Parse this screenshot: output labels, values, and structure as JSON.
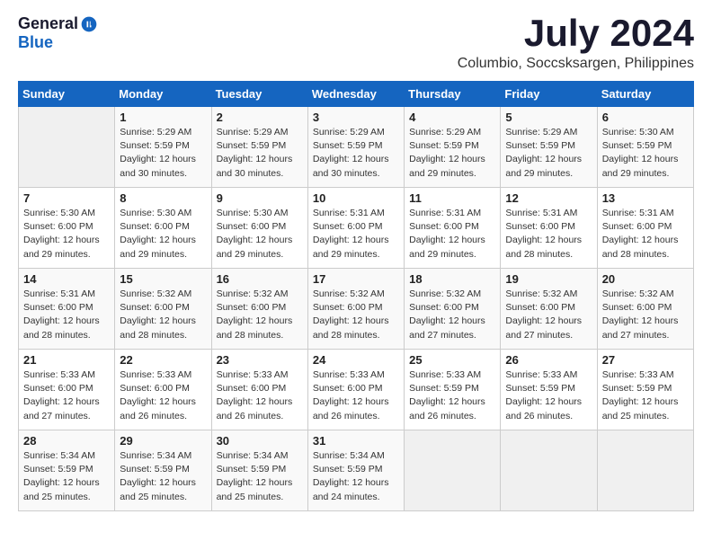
{
  "logo": {
    "general": "General",
    "blue": "Blue"
  },
  "title": {
    "month_year": "July 2024",
    "location": "Columbio, Soccsksargen, Philippines"
  },
  "calendar": {
    "headers": [
      "Sunday",
      "Monday",
      "Tuesday",
      "Wednesday",
      "Thursday",
      "Friday",
      "Saturday"
    ],
    "weeks": [
      [
        {
          "day": "",
          "info": ""
        },
        {
          "day": "1",
          "info": "Sunrise: 5:29 AM\nSunset: 5:59 PM\nDaylight: 12 hours\nand 30 minutes."
        },
        {
          "day": "2",
          "info": "Sunrise: 5:29 AM\nSunset: 5:59 PM\nDaylight: 12 hours\nand 30 minutes."
        },
        {
          "day": "3",
          "info": "Sunrise: 5:29 AM\nSunset: 5:59 PM\nDaylight: 12 hours\nand 30 minutes."
        },
        {
          "day": "4",
          "info": "Sunrise: 5:29 AM\nSunset: 5:59 PM\nDaylight: 12 hours\nand 29 minutes."
        },
        {
          "day": "5",
          "info": "Sunrise: 5:29 AM\nSunset: 5:59 PM\nDaylight: 12 hours\nand 29 minutes."
        },
        {
          "day": "6",
          "info": "Sunrise: 5:30 AM\nSunset: 5:59 PM\nDaylight: 12 hours\nand 29 minutes."
        }
      ],
      [
        {
          "day": "7",
          "info": "Sunrise: 5:30 AM\nSunset: 6:00 PM\nDaylight: 12 hours\nand 29 minutes."
        },
        {
          "day": "8",
          "info": "Sunrise: 5:30 AM\nSunset: 6:00 PM\nDaylight: 12 hours\nand 29 minutes."
        },
        {
          "day": "9",
          "info": "Sunrise: 5:30 AM\nSunset: 6:00 PM\nDaylight: 12 hours\nand 29 minutes."
        },
        {
          "day": "10",
          "info": "Sunrise: 5:31 AM\nSunset: 6:00 PM\nDaylight: 12 hours\nand 29 minutes."
        },
        {
          "day": "11",
          "info": "Sunrise: 5:31 AM\nSunset: 6:00 PM\nDaylight: 12 hours\nand 29 minutes."
        },
        {
          "day": "12",
          "info": "Sunrise: 5:31 AM\nSunset: 6:00 PM\nDaylight: 12 hours\nand 28 minutes."
        },
        {
          "day": "13",
          "info": "Sunrise: 5:31 AM\nSunset: 6:00 PM\nDaylight: 12 hours\nand 28 minutes."
        }
      ],
      [
        {
          "day": "14",
          "info": "Sunrise: 5:31 AM\nSunset: 6:00 PM\nDaylight: 12 hours\nand 28 minutes."
        },
        {
          "day": "15",
          "info": "Sunrise: 5:32 AM\nSunset: 6:00 PM\nDaylight: 12 hours\nand 28 minutes."
        },
        {
          "day": "16",
          "info": "Sunrise: 5:32 AM\nSunset: 6:00 PM\nDaylight: 12 hours\nand 28 minutes."
        },
        {
          "day": "17",
          "info": "Sunrise: 5:32 AM\nSunset: 6:00 PM\nDaylight: 12 hours\nand 28 minutes."
        },
        {
          "day": "18",
          "info": "Sunrise: 5:32 AM\nSunset: 6:00 PM\nDaylight: 12 hours\nand 27 minutes."
        },
        {
          "day": "19",
          "info": "Sunrise: 5:32 AM\nSunset: 6:00 PM\nDaylight: 12 hours\nand 27 minutes."
        },
        {
          "day": "20",
          "info": "Sunrise: 5:32 AM\nSunset: 6:00 PM\nDaylight: 12 hours\nand 27 minutes."
        }
      ],
      [
        {
          "day": "21",
          "info": "Sunrise: 5:33 AM\nSunset: 6:00 PM\nDaylight: 12 hours\nand 27 minutes."
        },
        {
          "day": "22",
          "info": "Sunrise: 5:33 AM\nSunset: 6:00 PM\nDaylight: 12 hours\nand 26 minutes."
        },
        {
          "day": "23",
          "info": "Sunrise: 5:33 AM\nSunset: 6:00 PM\nDaylight: 12 hours\nand 26 minutes."
        },
        {
          "day": "24",
          "info": "Sunrise: 5:33 AM\nSunset: 6:00 PM\nDaylight: 12 hours\nand 26 minutes."
        },
        {
          "day": "25",
          "info": "Sunrise: 5:33 AM\nSunset: 5:59 PM\nDaylight: 12 hours\nand 26 minutes."
        },
        {
          "day": "26",
          "info": "Sunrise: 5:33 AM\nSunset: 5:59 PM\nDaylight: 12 hours\nand 26 minutes."
        },
        {
          "day": "27",
          "info": "Sunrise: 5:33 AM\nSunset: 5:59 PM\nDaylight: 12 hours\nand 25 minutes."
        }
      ],
      [
        {
          "day": "28",
          "info": "Sunrise: 5:34 AM\nSunset: 5:59 PM\nDaylight: 12 hours\nand 25 minutes."
        },
        {
          "day": "29",
          "info": "Sunrise: 5:34 AM\nSunset: 5:59 PM\nDaylight: 12 hours\nand 25 minutes."
        },
        {
          "day": "30",
          "info": "Sunrise: 5:34 AM\nSunset: 5:59 PM\nDaylight: 12 hours\nand 25 minutes."
        },
        {
          "day": "31",
          "info": "Sunrise: 5:34 AM\nSunset: 5:59 PM\nDaylight: 12 hours\nand 24 minutes."
        },
        {
          "day": "",
          "info": ""
        },
        {
          "day": "",
          "info": ""
        },
        {
          "day": "",
          "info": ""
        }
      ]
    ]
  }
}
